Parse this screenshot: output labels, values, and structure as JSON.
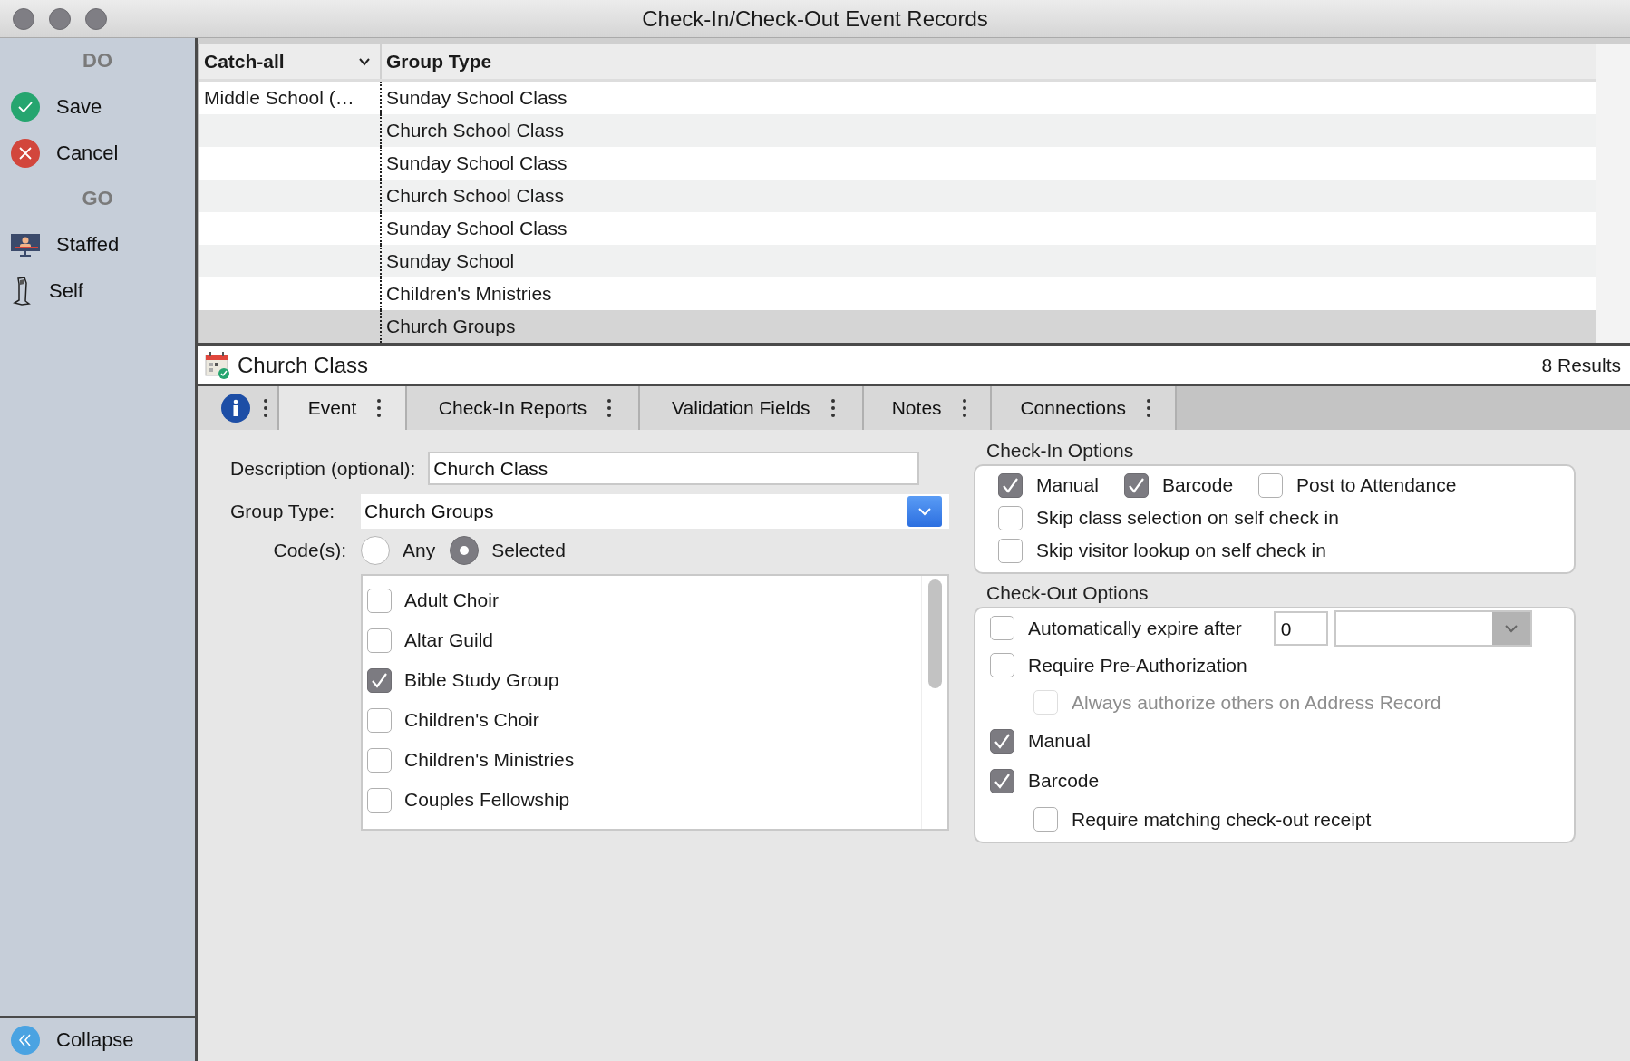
{
  "window": {
    "title": "Check-In/Check-Out Event Records"
  },
  "sidebar": {
    "sections": [
      {
        "heading": "DO",
        "items": [
          {
            "label": "Save",
            "kind": "save"
          },
          {
            "label": "Cancel",
            "kind": "cancel"
          }
        ]
      },
      {
        "heading": "GO",
        "items": [
          {
            "label": "Staffed",
            "kind": "staffed"
          },
          {
            "label": "Self",
            "kind": "self"
          }
        ]
      }
    ],
    "collapse": {
      "label": "Collapse"
    }
  },
  "table": {
    "columns": [
      "Catch-all",
      "Group Type"
    ],
    "rows": [
      {
        "cells": [
          "Middle School (…",
          "Sunday School Class"
        ],
        "selected": false
      },
      {
        "cells": [
          "",
          "Church School Class"
        ],
        "selected": false
      },
      {
        "cells": [
          "",
          "Sunday School Class"
        ],
        "selected": false
      },
      {
        "cells": [
          "",
          "Church School Class"
        ],
        "selected": false
      },
      {
        "cells": [
          "",
          "Sunday School Class"
        ],
        "selected": false
      },
      {
        "cells": [
          "",
          "Sunday School"
        ],
        "selected": false
      },
      {
        "cells": [
          "",
          "Children's Mnistries"
        ],
        "selected": false
      },
      {
        "cells": [
          "",
          "Church Groups"
        ],
        "selected": true
      }
    ]
  },
  "record": {
    "title": "Church Class",
    "results": "8 Results"
  },
  "tabs": [
    {
      "label": "Event",
      "selected": true
    },
    {
      "label": "Check-In Reports",
      "selected": false
    },
    {
      "label": "Validation Fields",
      "selected": false
    },
    {
      "label": "Notes",
      "selected": false
    },
    {
      "label": "Connections",
      "selected": false
    }
  ],
  "form": {
    "description": {
      "label": "Description (optional):",
      "value": "Church Class"
    },
    "group_type": {
      "label": "Group Type:",
      "value": "Church Groups"
    },
    "codes": {
      "label": "Code(s):",
      "options": [
        {
          "label": "Any",
          "selected": false
        },
        {
          "label": "Selected",
          "selected": true
        }
      ],
      "items": [
        {
          "label": "Adult Choir",
          "checked": false
        },
        {
          "label": "Altar Guild",
          "checked": false
        },
        {
          "label": "Bible Study Group",
          "checked": true
        },
        {
          "label": "Children's Choir",
          "checked": false
        },
        {
          "label": "Children's Ministries",
          "checked": false
        },
        {
          "label": "Couples Fellowship",
          "checked": false
        }
      ]
    }
  },
  "check_in_options": {
    "title": "Check-In Options",
    "rows": [
      [
        {
          "label": "Manual",
          "checked": true
        },
        {
          "label": "Barcode",
          "checked": true
        },
        {
          "label": "Post to Attendance",
          "checked": false
        }
      ],
      [
        {
          "label": "Skip class selection on self check in",
          "checked": false
        }
      ],
      [
        {
          "label": "Skip visitor lookup on self check in",
          "checked": false
        }
      ]
    ]
  },
  "check_out_options": {
    "title": "Check-Out Options",
    "items": [
      {
        "kind": "expire",
        "label": "Automatically expire after",
        "checked": false,
        "value": "0"
      },
      {
        "kind": "plain",
        "label": "Require Pre-Authorization",
        "checked": false
      },
      {
        "kind": "sub",
        "label": "Always authorize others on Address Record",
        "checked": false,
        "disabled": true
      },
      {
        "kind": "plain",
        "label": "Manual",
        "checked": true
      },
      {
        "kind": "plain",
        "label": "Barcode",
        "checked": true
      },
      {
        "kind": "sub",
        "label": "Require matching check-out receipt",
        "checked": false,
        "disabled": false
      }
    ]
  }
}
